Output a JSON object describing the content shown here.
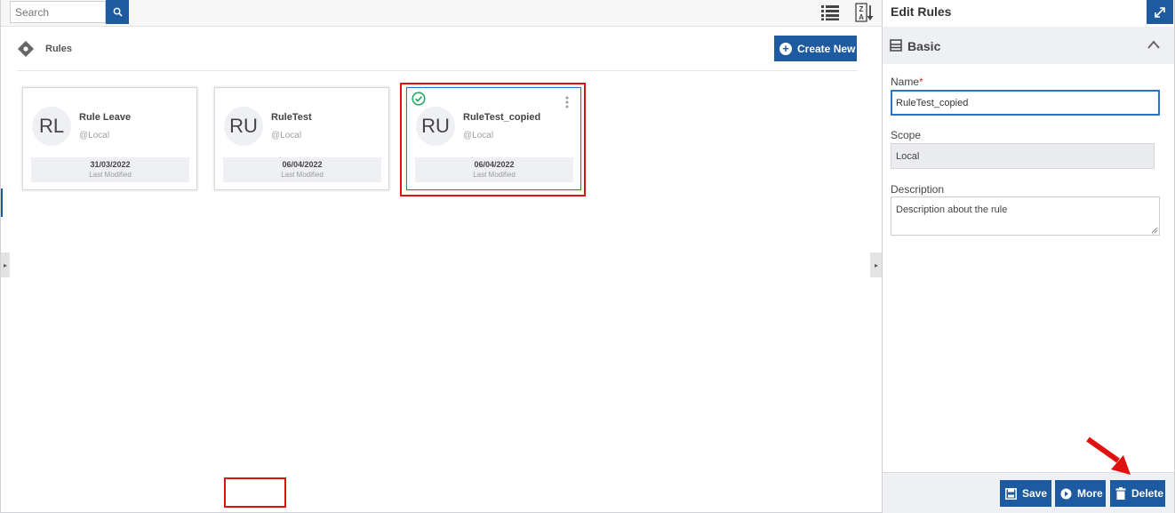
{
  "toolbar": {
    "search_placeholder": "Search",
    "search_icon": "magnifier-icon",
    "list_view_icon": "list-view-icon",
    "sort_icon": "sort-za-icon"
  },
  "header": {
    "title": "Rules",
    "create_label": "Create New"
  },
  "cards": [
    {
      "initials": "RL",
      "name": "Rule Leave",
      "scope": "@Local",
      "date": "31/03/2022",
      "date_label": "Last Modified",
      "selected": false
    },
    {
      "initials": "RU",
      "name": "RuleTest",
      "scope": "@Local",
      "date": "06/04/2022",
      "date_label": "Last Modified",
      "selected": false
    },
    {
      "initials": "RU",
      "name": "RuleTest_copied",
      "scope": "@Local",
      "date": "06/04/2022",
      "date_label": "Last Modified",
      "selected": true
    }
  ],
  "panel": {
    "title": "Edit Rules",
    "section_title": "Basic",
    "name_label": "Name",
    "name_required_mark": "*",
    "name_value": "RuleTest_copied",
    "scope_label": "Scope",
    "scope_value": "Local",
    "description_label": "Description",
    "description_value": "Description about the rule",
    "save_label": "Save",
    "more_label": "More",
    "delete_label": "Delete"
  },
  "colors": {
    "primary": "#1e5aa0",
    "highlight": "#e01010",
    "success": "#2aa865",
    "selected_border": "#2a72c8"
  }
}
